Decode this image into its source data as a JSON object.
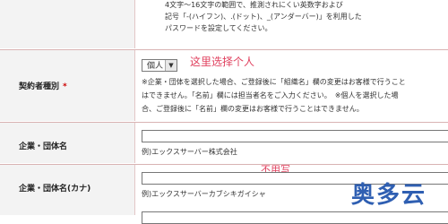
{
  "password_note": [
    "4文字～16文字の範囲で、推測されにくい英数字および",
    "記号「-(ハイフン)、.(ドット)、_(アンダーバー)」を利用した",
    "パスワードを設定してください。"
  ],
  "contract_type": {
    "label": "契約者種別",
    "required_mark": "*",
    "select_value": "個人",
    "annotation": "这里选择个人",
    "note": [
      "※企業・団体を選択した場合、ご登録後に「組織名」欄の変更はお客様で行うこと",
      "はできません。「名前」欄には担当者名をご入力ください。　※個人を選択した場",
      "合、ご登録後に「名前」欄の変更はお客様で行うことはできません。"
    ]
  },
  "company_name": {
    "label": "企業・団体名",
    "value": "",
    "example": "例)エックスサーバー株式会社"
  },
  "company_kana": {
    "label": "企業・団体名(カナ)",
    "value": "",
    "annotation": "不用写",
    "example": "例)エックスサーバーカブシキガイシャ"
  },
  "watermark": "奥多云",
  "colors": {
    "annotation": "#e0405e",
    "required": "#cc0000",
    "logo": "#2f5fb2",
    "label_bg": "#f3f3f3",
    "divider": "#d9b3b3"
  }
}
